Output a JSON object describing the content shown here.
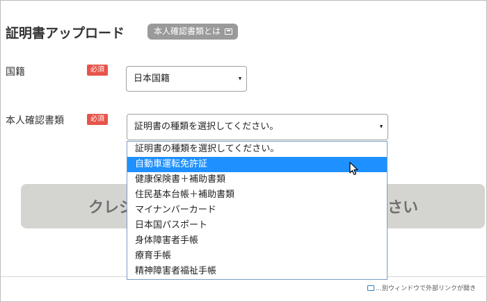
{
  "page": {
    "title": "証明書アップロード",
    "help_badge": "本人確認書類とは"
  },
  "form": {
    "nationality": {
      "label": "国籍",
      "required": "必須",
      "value": "日本国籍"
    },
    "id_document": {
      "label": "本人確認書類",
      "required": "必須",
      "value": "証明書の種類を選択してください。",
      "options": [
        "証明書の種類を選択してください。",
        "自動車運転免許証",
        "健康保険書＋補助書類",
        "住民基本台帳＋補助書類",
        "マイナンバーカード",
        "日本国パスポート",
        "身体障害者手帳",
        "療育手帳",
        "精神障害者福祉手帳"
      ],
      "highlighted_index": 1
    }
  },
  "button": {
    "text_left": "クレジ",
    "text_right": "さい"
  },
  "footer": {
    "note": "…別ウィンドウで外部リンクが開き"
  },
  "colors": {
    "required_badge": "#e6544b",
    "help_badge": "#9a9a9a",
    "highlight": "#1e90ff",
    "button_bg": "#d4d4d0"
  },
  "icons": {
    "external_link": "external-window-icon",
    "select_arrow": "triangle-down-icon",
    "pointer": "mouse-pointer-icon"
  }
}
